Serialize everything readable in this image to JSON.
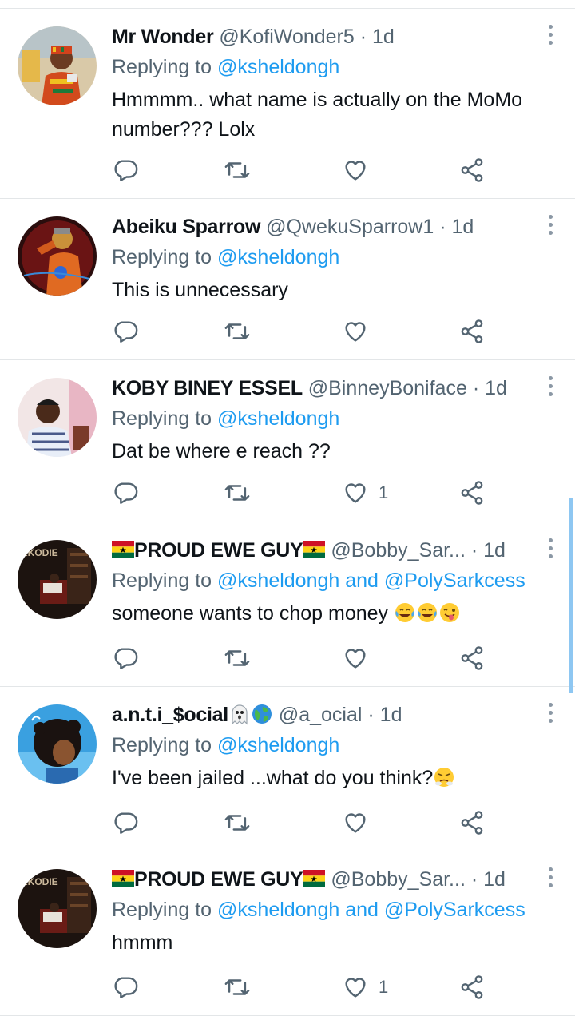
{
  "replies": [
    {
      "name": "Mr Wonder",
      "handle": "@KofiWonder5",
      "time": "1d",
      "replying_prefix": "Replying to",
      "replying_to": "@ksheldongh",
      "text": "Hmmmm.. what name is actually on the MoMo number??? Lolx",
      "like_count": "",
      "avatar_icon": "child-in-kente-avatar"
    },
    {
      "name": "Abeiku Sparrow",
      "handle": "@QwekuSparrow1",
      "time": "1d",
      "replying_prefix": "Replying to",
      "replying_to": "@ksheldongh",
      "text": "This is unnecessary",
      "like_count": "",
      "avatar_icon": "performer-avatar"
    },
    {
      "name": "KOBY BINEY ESSEL",
      "handle": "@BinneyBoniface",
      "time": "1d",
      "replying_prefix": "Replying to",
      "replying_to": "@ksheldongh",
      "text": "Dat be where e reach ??",
      "like_count": "1",
      "avatar_icon": "boy-avatar"
    },
    {
      "name": "PROUD EWE GUY",
      "handle": "@Bobby_Sar...",
      "time": "1d",
      "replying_prefix": "Replying to",
      "replying_to": "@ksheldongh and @PolySarkcess",
      "text": "someone wants to chop money",
      "like_count": "",
      "avatar_icon": "sarkodie-album-avatar",
      "avatar_text": "RKODIE"
    },
    {
      "name": "a.n.t.i_$ocial",
      "handle": "@a_ocial",
      "time": "1d",
      "replying_prefix": "Replying to",
      "replying_to": "@ksheldongh",
      "text": "I've been jailed ...what do you think?",
      "like_count": "",
      "avatar_icon": "cartoon-child-avatar"
    },
    {
      "name": "PROUD EWE GUY",
      "handle": "@Bobby_Sar...",
      "time": "1d",
      "replying_prefix": "Replying to",
      "replying_to": "@ksheldongh and @PolySarkcess",
      "text": "hmmm",
      "like_count": "1",
      "avatar_icon": "sarkodie-album-avatar",
      "avatar_text": "RKODIE"
    }
  ],
  "separator": "·",
  "icons": [
    "reply-icon",
    "retweet-icon",
    "like-icon",
    "share-icon",
    "more-options-icon"
  ],
  "colors": {
    "link": "#1d9bf0",
    "secondary": "#536471",
    "divider": "#e3e6e8"
  }
}
